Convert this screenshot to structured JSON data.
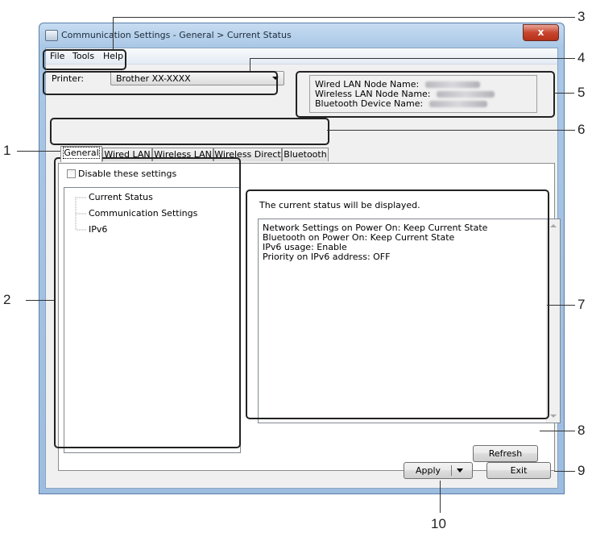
{
  "window": {
    "title": "Communication Settings - General > Current Status",
    "close_label": "x"
  },
  "menu": {
    "file": "File",
    "tools": "Tools",
    "help": "Help"
  },
  "printer": {
    "label": "Printer:",
    "value": "Brother XX-XXXX"
  },
  "node_info": {
    "wired_label": "Wired LAN Node Name:",
    "wireless_label": "Wireless LAN Node Name:",
    "bluetooth_label": "Bluetooth Device Name:"
  },
  "tabs": [
    {
      "label": "General",
      "active": true
    },
    {
      "label": "Wired LAN",
      "active": false
    },
    {
      "label": "Wireless LAN",
      "active": false
    },
    {
      "label": "Wireless Direct",
      "active": false
    },
    {
      "label": "Bluetooth",
      "active": false
    }
  ],
  "disable_checkbox_label": "Disable these settings",
  "tree_items": [
    "Current Status",
    "Communication Settings",
    "IPv6"
  ],
  "status": {
    "heading": "The current status will be displayed.",
    "lines": [
      "Network Settings on Power On: Keep Current State",
      "Bluetooth on Power On: Keep Current State",
      "IPv6 usage: Enable",
      "Priority on IPv6 address: OFF"
    ]
  },
  "buttons": {
    "refresh": "Refresh",
    "apply": "Apply",
    "exit": "Exit"
  },
  "callouts": [
    "1",
    "2",
    "3",
    "4",
    "5",
    "6",
    "7",
    "8",
    "9",
    "10"
  ],
  "colors": {
    "callout_box": "#222222",
    "title_gradient": "#a9c7e6",
    "close_button": "#c8452f"
  }
}
